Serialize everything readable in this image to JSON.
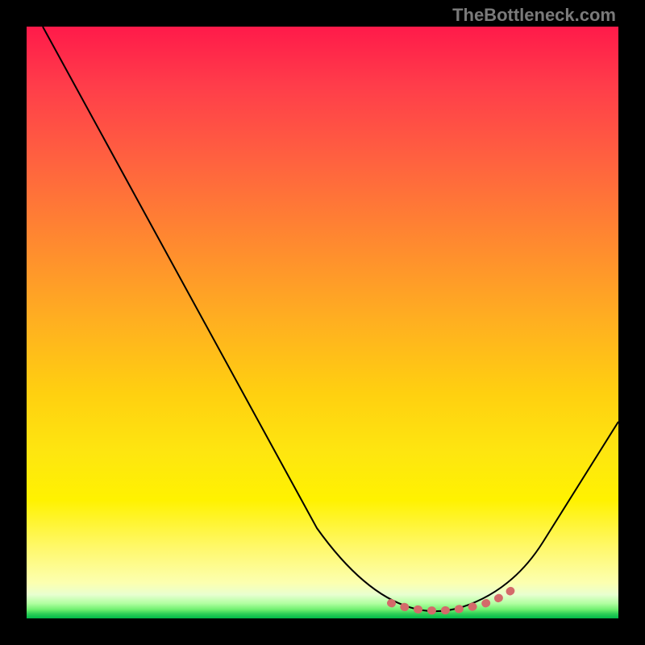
{
  "attribution": "TheBottleneck.com",
  "colors": {
    "gradient_top": "#ff1a4a",
    "gradient_mid_upper": "#ff8830",
    "gradient_mid": "#ffd010",
    "gradient_lower": "#fff86a",
    "gradient_bottom": "#00b848",
    "curve": "#000000",
    "dots": "#d46a6a",
    "frame": "#000000"
  },
  "chart_data": {
    "type": "line",
    "title": "",
    "xlabel": "",
    "ylabel": "",
    "xlim": [
      0,
      100
    ],
    "ylim": [
      0,
      100
    ],
    "x": [
      3,
      10,
      20,
      30,
      40,
      49,
      55,
      61,
      68,
      74,
      80,
      86,
      93,
      100
    ],
    "values": [
      100,
      88,
      71,
      54,
      36,
      18,
      8,
      2,
      0,
      0,
      2,
      8,
      20,
      34
    ],
    "sweet_spot_range_x": [
      61,
      83
    ],
    "notes": "Single continuous black curve over a vertical red-to-green gradient; curve minimum (≈0) around x≈68–74 marked with a short coral dotted segment. No axis ticks, labels, or legend are rendered."
  }
}
